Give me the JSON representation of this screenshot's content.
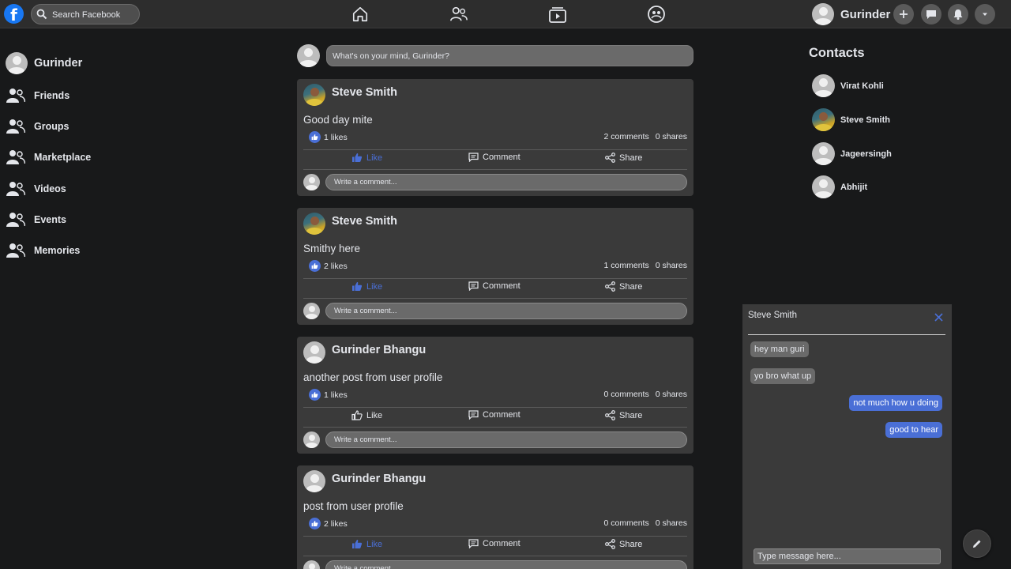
{
  "header": {
    "logo_letter": "f",
    "search_placeholder": "Search Facebook",
    "user_name": "Gurinder",
    "nav_icons": [
      "home-icon",
      "friends-icon",
      "watch-icon",
      "groups-icon"
    ],
    "action_icons": [
      "plus-icon",
      "messenger-icon",
      "bell-icon",
      "caret-down-icon"
    ]
  },
  "sidebar": {
    "profile_name": "Gurinder",
    "items": [
      {
        "label": "Friends",
        "icon": "people-icon"
      },
      {
        "label": "Groups",
        "icon": "people-icon"
      },
      {
        "label": "Marketplace",
        "icon": "people-icon"
      },
      {
        "label": "Videos",
        "icon": "people-icon"
      },
      {
        "label": "Events",
        "icon": "people-icon"
      },
      {
        "label": "Memories",
        "icon": "people-icon"
      }
    ]
  },
  "composer": {
    "placeholder": "What's on your mind, Gurinder?"
  },
  "posts": [
    {
      "author": "Steve Smith",
      "text": "Good day mite",
      "likes": "1 likes",
      "comments": "2 comments",
      "shares": "0 shares",
      "liked": true,
      "photo": true
    },
    {
      "author": "Steve Smith",
      "text": "Smithy here",
      "likes": "2 likes",
      "comments": "1 comments",
      "shares": "0 shares",
      "liked": true,
      "photo": true
    },
    {
      "author": "Gurinder Bhangu",
      "text": "another post from user profile",
      "likes": "1 likes",
      "comments": "0 comments",
      "shares": "0 shares",
      "liked": false,
      "photo": false
    },
    {
      "author": "Gurinder Bhangu",
      "text": "post from user profile",
      "likes": "2 likes",
      "comments": "0 comments",
      "shares": "0 shares",
      "liked": true,
      "photo": false
    }
  ],
  "post_actions": {
    "like": "Like",
    "comment": "Comment",
    "share": "Share",
    "comment_placeholder": "Write a comment..."
  },
  "contacts": {
    "title": "Contacts",
    "items": [
      {
        "name": "Virat Kohli",
        "photo": false
      },
      {
        "name": "Steve Smith",
        "photo": true
      },
      {
        "name": "Jageersingh",
        "photo": false
      },
      {
        "name": "Abhijit",
        "photo": false
      }
    ]
  },
  "chat": {
    "title": "Steve Smith",
    "messages": [
      {
        "text": "hey man guri",
        "from": "them"
      },
      {
        "text": "yo bro what up",
        "from": "them"
      },
      {
        "text": "not much how u doing",
        "from": "me"
      },
      {
        "text": "good to hear",
        "from": "me"
      }
    ],
    "input_placeholder": "Type message here..."
  },
  "colors": {
    "accent": "#4a6fd6",
    "background": "#18191a",
    "card": "#3a3a3a",
    "brand": "#1877f2"
  }
}
